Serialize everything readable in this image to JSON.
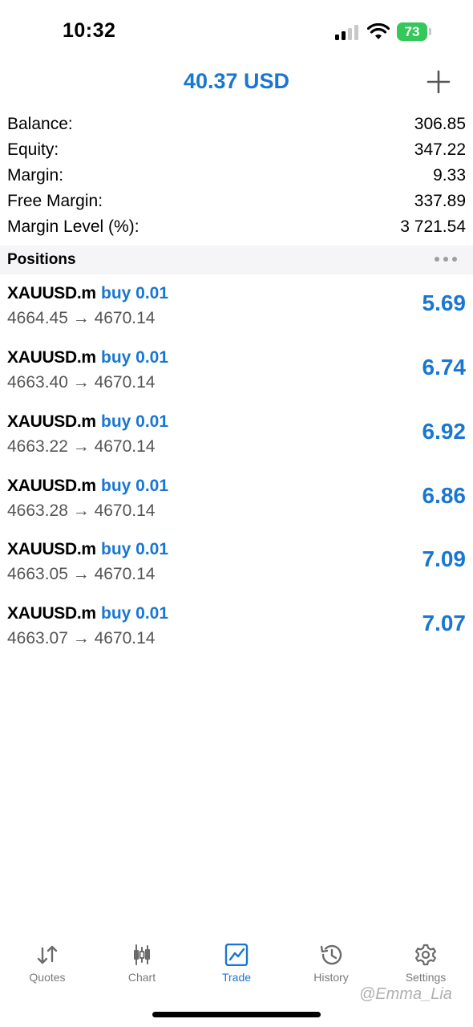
{
  "status_bar": {
    "time": "10:32",
    "battery": "73"
  },
  "header": {
    "title": "40.37 USD"
  },
  "summary": [
    {
      "label": "Balance:",
      "value": "306.85"
    },
    {
      "label": "Equity:",
      "value": "347.22"
    },
    {
      "label": "Margin:",
      "value": "9.33"
    },
    {
      "label": "Free Margin:",
      "value": "337.89"
    },
    {
      "label": "Margin Level (%):",
      "value": "3 721.54"
    }
  ],
  "positions": {
    "title": "Positions",
    "items": [
      {
        "symbol": "XAUUSD.m",
        "side": "buy 0.01",
        "prices": "4664.45 → 4670.14",
        "profit": "5.69"
      },
      {
        "symbol": "XAUUSD.m",
        "side": "buy 0.01",
        "prices": "4663.40 → 4670.14",
        "profit": "6.74"
      },
      {
        "symbol": "XAUUSD.m",
        "side": "buy 0.01",
        "prices": "4663.22 → 4670.14",
        "profit": "6.92"
      },
      {
        "symbol": "XAUUSD.m",
        "side": "buy 0.01",
        "prices": "4663.28 → 4670.14",
        "profit": "6.86"
      },
      {
        "symbol": "XAUUSD.m",
        "side": "buy 0.01",
        "prices": "4663.05 → 4670.14",
        "profit": "7.09"
      },
      {
        "symbol": "XAUUSD.m",
        "side": "buy 0.01",
        "prices": "4663.07 → 4670.14",
        "profit": "7.07"
      }
    ]
  },
  "tabs": [
    {
      "label": "Quotes",
      "icon": "quotes-arrows-icon"
    },
    {
      "label": "Chart",
      "icon": "candlestick-icon"
    },
    {
      "label": "Trade",
      "icon": "trade-chart-icon",
      "active": true
    },
    {
      "label": "History",
      "icon": "history-clock-icon"
    },
    {
      "label": "Settings",
      "icon": "gear-icon"
    }
  ],
  "watermark": "@Emma_Lia",
  "colors": {
    "accent": "#1976d2",
    "battery": "#34c759",
    "inactive_tab": "#7a7a7a"
  }
}
